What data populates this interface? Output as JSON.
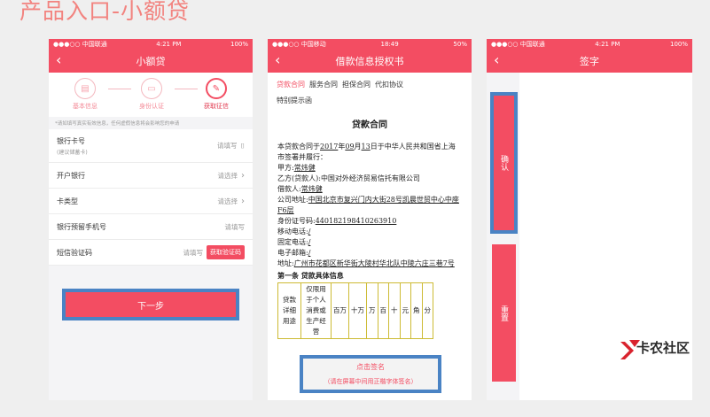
{
  "page_title": "产品入口-小额贷",
  "colors": {
    "accent": "#f34d62",
    "highlight_border": "#4a83c4",
    "background": "#efefef"
  },
  "phone1": {
    "status": {
      "carrier": "●●●○○ 中国联通 ",
      "time": "4:21 PM",
      "battery": "100%"
    },
    "nav_title": "小额贷",
    "steps": [
      {
        "label": "基本信息",
        "icon": "document-icon"
      },
      {
        "label": "身份认证",
        "icon": "id-card-icon"
      },
      {
        "label": "获取征信",
        "icon": "credit-report-icon"
      }
    ],
    "notice": "*请如填写真实有效信息，任何虚假信息将会影响您的申请",
    "fields": [
      {
        "label": "银行卡号",
        "sub": "(建议储蓄卡)",
        "value": "请填写"
      },
      {
        "label": "开户银行",
        "value": "请选择"
      },
      {
        "label": "卡类型",
        "value": "请选择"
      },
      {
        "label": "银行预留手机号",
        "value": "请填写"
      },
      {
        "label": "短信验证码",
        "value": "请填写",
        "button": "获取验证码"
      }
    ],
    "next_button": "下一步"
  },
  "phone2": {
    "status": {
      "carrier": "●●●○○ 中国移动 ",
      "time": "18:49",
      "battery": "50%"
    },
    "nav_title": "借款信息授权书",
    "tabs": [
      "贷款合同",
      "服务合同",
      "担保合同",
      "代扣协议",
      "特别提示函"
    ],
    "contract": {
      "title": "贷款合同",
      "intro_pre": "本贷款合同于",
      "year": "2017",
      "year_suffix": "年",
      "month": "09",
      "month_suffix": "月",
      "day": "13",
      "intro_post": "日于中华人民共和国",
      "province": "省上海市",
      "intro_end": "签署并履行：",
      "party_a_label": "甲方:",
      "party_a": "常炜健",
      "party_b_label": "乙方(贷款人):",
      "party_b": "中国对外经济贸易信托有限公司",
      "borrower_label": "借款人:",
      "borrower": "常炜健",
      "company_addr_label": "公司地址:",
      "company_addr": "中国北京市复兴门内大街28号凯晨世贸中心中座F6层",
      "id_label": "身份证号码:",
      "id_number": "440182198410263910",
      "mobile_label": "移动电话:",
      "mobile": "/",
      "phone_label": "固定电话:",
      "phone": "/",
      "email_label": "电子邮箱:",
      "email": "/",
      "address_label": "地址:",
      "address": "广州市花都区新华街大陵村华北队中陵六庄三巷7号",
      "section1": "第一条 贷款具体信息",
      "table": {
        "row_label": "贷款详细用途",
        "purpose": "仅限用于个人消费或生产经营",
        "units": [
          "百万",
          "十万",
          "万",
          "百",
          "十",
          "元",
          "角",
          "分"
        ]
      }
    },
    "sign": {
      "line1": "点击签名",
      "line2": "（请在屏幕中间用正楷字体签名）"
    }
  },
  "phone3": {
    "status": {
      "carrier": "●●●○○ 中国联通 ",
      "time": "4:21 PM",
      "battery": "100%"
    },
    "nav_title": "签字",
    "confirm_button": "确认",
    "reset_button": "重置"
  },
  "watermark": "卡农社区"
}
